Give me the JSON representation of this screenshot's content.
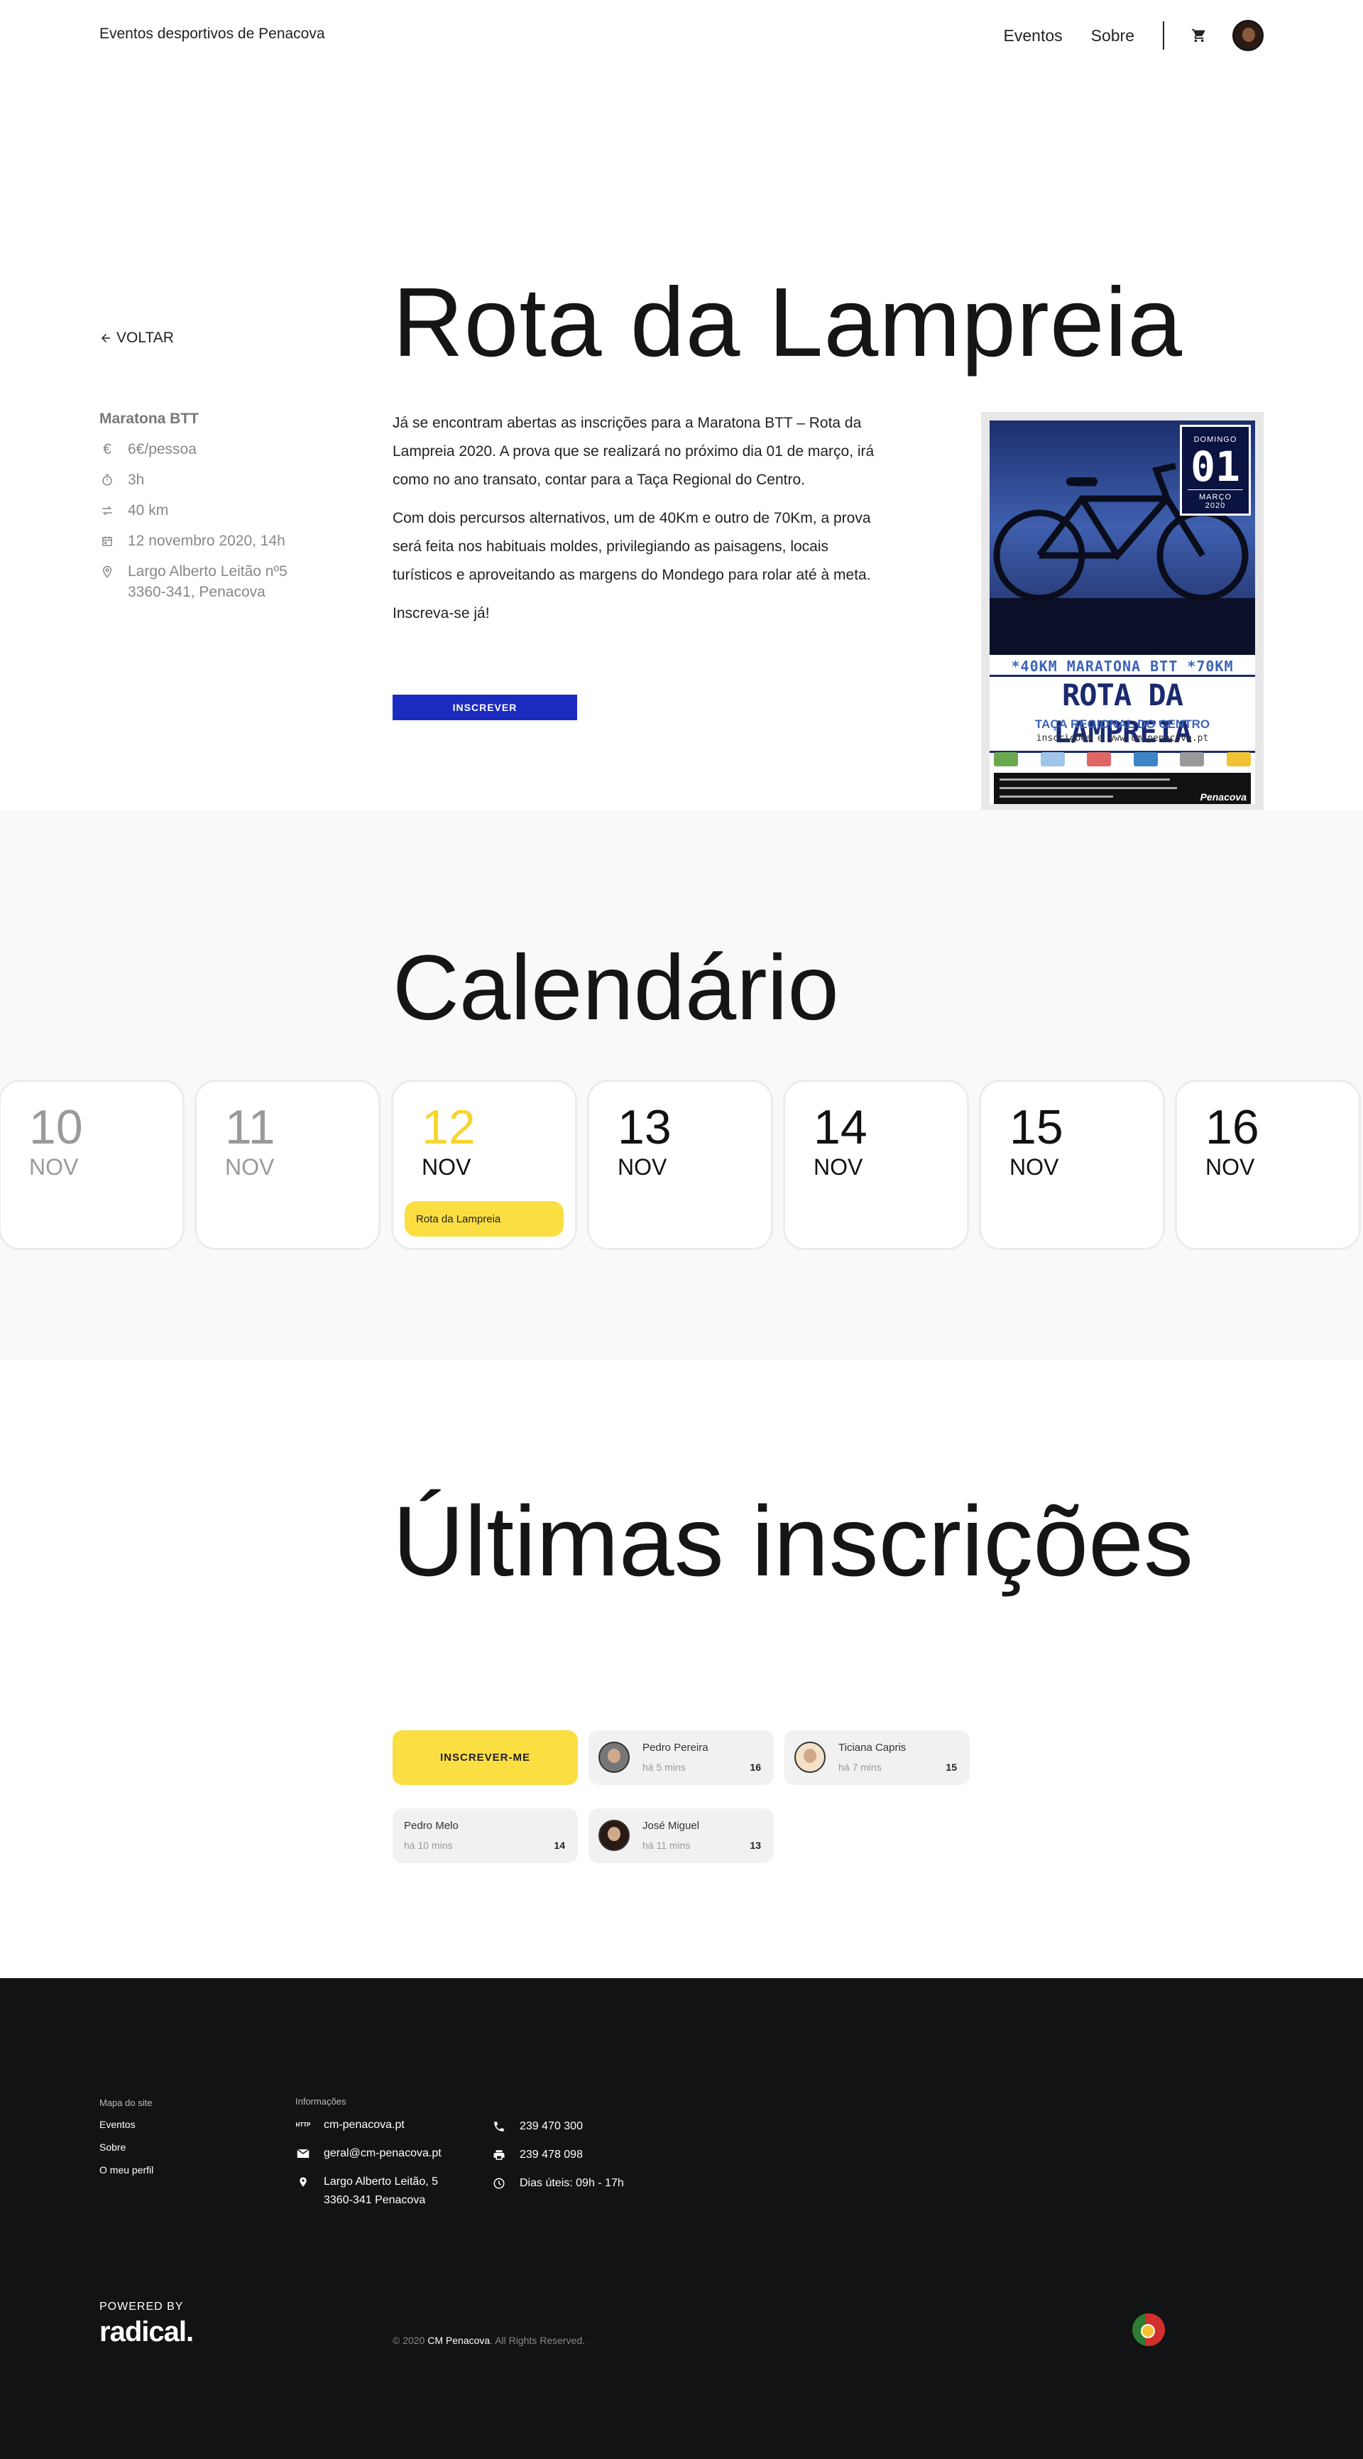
{
  "header": {
    "site_title": "Eventos desportivos de Penacova",
    "nav": {
      "events": "Eventos",
      "about": "Sobre"
    }
  },
  "event": {
    "title": "Rota da Lampreia",
    "back_label": "VOLTAR",
    "type": "Maratona BTT",
    "price": "6€/pessoa",
    "duration": "3h",
    "distance": "40 km",
    "date": "12 novembro 2020, 14h",
    "address_line1": "Largo Alberto Leitão nº5",
    "address_line2": "3360-341, Penacova",
    "description": [
      "Já se encontram abertas as inscrições para a Maratona BTT – Rota da Lampreia 2020. A prova que se realizará no próximo dia 01 de março, irá como no ano transato, contar para a Taça Regional do Centro.",
      "Com dois percursos alternativos, um de 40Km e outro de 70Km, a prova será feita nos habituais moldes, privilegiando as paisagens, locais turísticos e aproveitando as margens do Mondego para rolar até à meta.",
      "Inscreva-se já!"
    ],
    "register_button": "INSCREVER",
    "poster": {
      "weekday": "DOMINGO",
      "day": "01",
      "month": "MARÇO 2020",
      "distances": "*40KM  MARATONA BTT  *70KM",
      "name": "ROTA DA LAMPREIA",
      "cup": "TAÇA REGIONAL DO CENTRO",
      "site": "inscrições e www.cm-penacova.pt",
      "brand": "Penacova"
    }
  },
  "calendar": {
    "title": "Calendário",
    "days": [
      {
        "day": "10",
        "month": "NOV",
        "state": "past"
      },
      {
        "day": "11",
        "month": "NOV",
        "state": "past"
      },
      {
        "day": "12",
        "month": "NOV",
        "state": "today",
        "event": "Rota da Lampreia"
      },
      {
        "day": "13",
        "month": "NOV",
        "state": "future"
      },
      {
        "day": "14",
        "month": "NOV",
        "state": "future"
      },
      {
        "day": "15",
        "month": "NOV",
        "state": "future"
      },
      {
        "day": "16",
        "month": "NOV",
        "state": "future"
      }
    ]
  },
  "registrations": {
    "title": "Últimas inscrições",
    "button": "INSCREVER-ME",
    "items": [
      {
        "name": "Pedro Pereira",
        "time": "há 5 mins",
        "number": "16"
      },
      {
        "name": "Ticiana Capris",
        "time": "há 7 mins",
        "number": "15"
      },
      {
        "name": "Pedro Melo",
        "time": "há 10 mins",
        "number": "14"
      },
      {
        "name": "José Miguel",
        "time": "há 11 mins",
        "number": "13"
      }
    ]
  },
  "footer": {
    "sitemap_heading": "Mapa do site",
    "sitemap_links": [
      "Eventos",
      "Sobre",
      "O meu perfil"
    ],
    "info_heading": "Informações",
    "website": "cm-penacova.pt",
    "email": "geral@cm-penacova.pt",
    "address_line1": "Largo Alberto Leitão, 5",
    "address_line2": "3360-341 Penacova",
    "phone": "239 470 300",
    "fax": "239 478 098",
    "hours": "Dias úteis: 09h - 17h",
    "powered_by": "POWERED BY",
    "brand": "radical.",
    "copyright_prefix": "© 2020",
    "copyright_owner": "CM Penacova",
    "copyright_suffix": ". All Rights Reserved."
  },
  "colors": {
    "accent_blue": "#1c2bbf",
    "accent_yellow": "#fbde42",
    "footer_bg": "#121314"
  }
}
